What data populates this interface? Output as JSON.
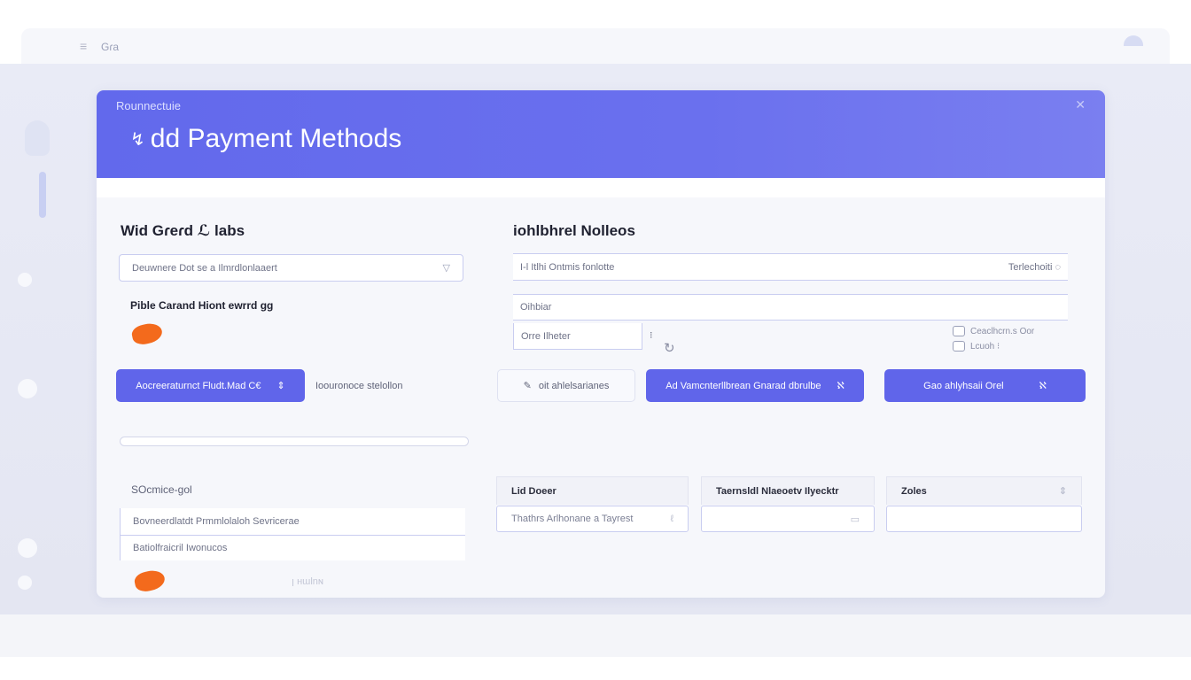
{
  "browser": {
    "menu_icon": "hamburger-icon",
    "tab_title": "Gɾa"
  },
  "header": {
    "breadcrumb": "Rounnectuie",
    "title": "dd Payment Methods",
    "back_glyph": "↯",
    "close_glyph": "✕"
  },
  "left_column": {
    "section_title": "Wid Gɾeɾd ℒ labs",
    "input": {
      "value": "Deuwnere Dot se a Ilmrdlonlaaert",
      "trail": "▽"
    },
    "sub_label": "Pible Carand Hiont ewrrd ɡɡ",
    "add_button": {
      "label": "Aocreeraturnct Fludt.Mad C€",
      "glyph": "⇕"
    },
    "add_button_note": "Ioouronoce stelollon",
    "schedule_label": "SOcmice-ɡol",
    "field_1": "Bovneerdlatdt Prmmlolaloh Sevricerae",
    "field_2": "Batiolfraicril Iwonucos",
    "footer_note": "ꞁ ʜɯlnɴ"
  },
  "right_column": {
    "section_title": "iohlbhrel Nolleos",
    "input": {
      "value": "I-l Itlhi Ontmis fonlotte",
      "trail": "Terlechoiti ◌"
    },
    "line_1": "Oihbiar",
    "line_2": "Orre Ilheter",
    "line_2_glyph": "⁝",
    "checks": [
      "Ceaclhcrn.s Oor",
      "Lcuoh   ⁝"
    ],
    "ghost_button": {
      "glyph": "✎",
      "label": "oit ahlelsarianes"
    },
    "primary_button_1": {
      "label": "Ad Vamcnterllbrean Gnarad dbrulbe",
      "glyph": "ℵ"
    },
    "primary_button_2": {
      "label": "Gao ahlyhsaii Orel",
      "glyph": "ℵ"
    },
    "table": {
      "headers": [
        "Lid Doeer",
        "Taernsldl Nlaeoetv Ilyecktr",
        "Zoles"
      ],
      "header_icons": [
        "",
        "",
        "⇕"
      ],
      "cells": [
        "Thathrs Arlhonane a Tayrest",
        "",
        ""
      ],
      "cell_icons": [
        "ℓ",
        "▭",
        ""
      ]
    }
  },
  "colors": {
    "accent": "#6065ea",
    "header_gradient_start": "#6269ec",
    "brand_orange": "#f36a1c",
    "field_border": "#c9cdf0"
  }
}
